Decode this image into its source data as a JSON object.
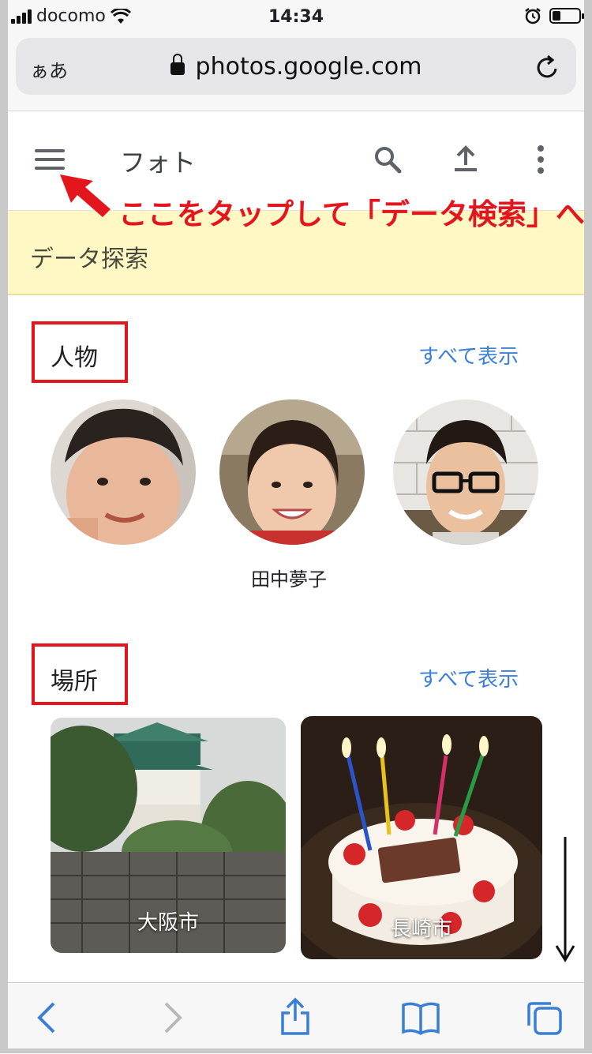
{
  "status_bar": {
    "carrier": "docomo",
    "time": "14:34",
    "battery_level": 0.3
  },
  "browser": {
    "aa_label": "ぁあ",
    "url": "photos.google.com"
  },
  "app_bar": {
    "title": "フォト"
  },
  "annotation": {
    "text": "ここをタップして「データ検索」へ",
    "color": "#e3151d"
  },
  "banner": {
    "text": "データ探索"
  },
  "people": {
    "title": "人物",
    "see_all": "すべて表示",
    "items": [
      {
        "name": ""
      },
      {
        "name": "田中夢子"
      },
      {
        "name": ""
      }
    ]
  },
  "places": {
    "title": "場所",
    "see_all": "すべて表示",
    "items": [
      {
        "label": "大阪市"
      },
      {
        "label": "長崎市"
      }
    ]
  },
  "colors": {
    "accent": "#3a7fd6",
    "highlight_box": "#e3151d",
    "banner_bg": "#fff8c4"
  }
}
